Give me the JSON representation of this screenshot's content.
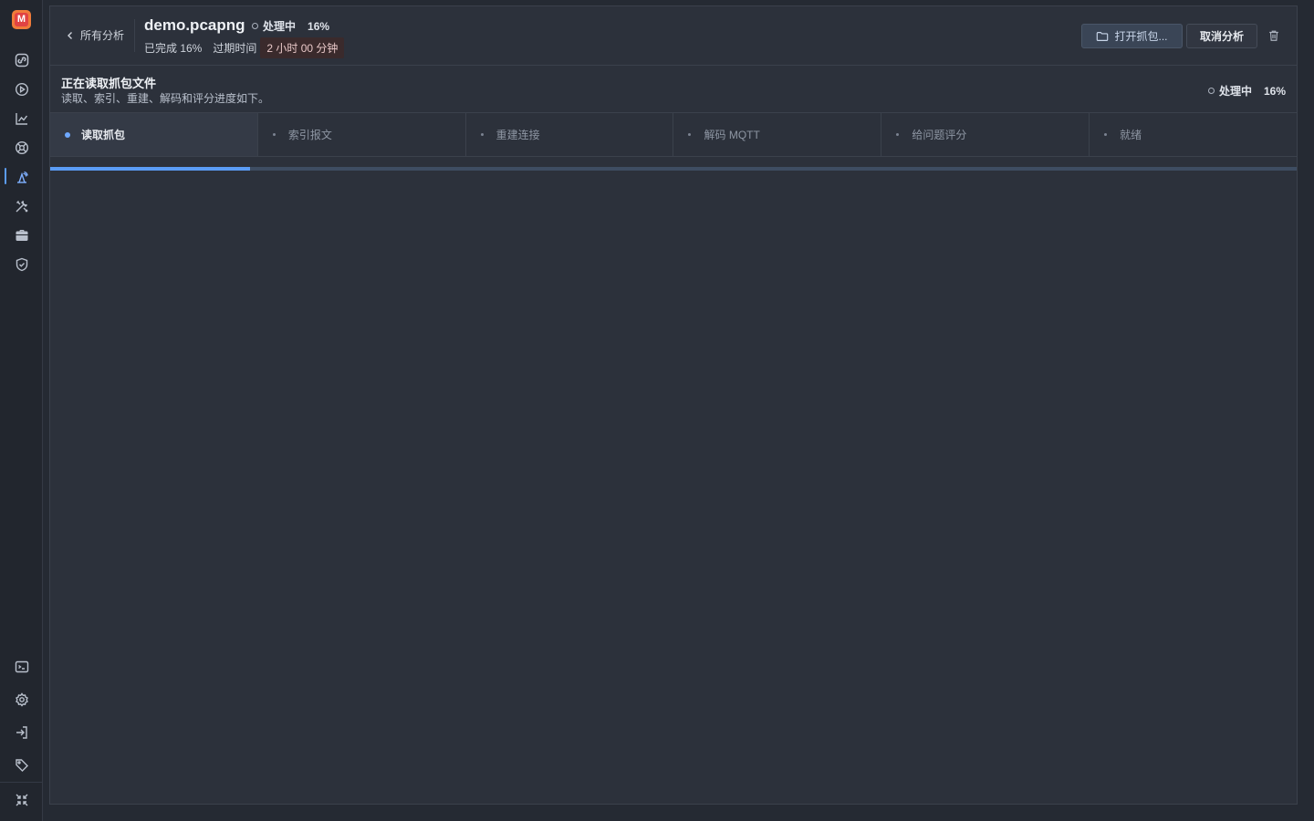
{
  "sidebar": {
    "logo_letter": "M",
    "items": [
      {
        "icon": "link-icon"
      },
      {
        "icon": "play-circle-icon"
      },
      {
        "icon": "chart-icon"
      },
      {
        "icon": "target-icon"
      },
      {
        "icon": "capture-icon",
        "active": true
      },
      {
        "icon": "tools-icon"
      },
      {
        "icon": "briefcase-icon"
      },
      {
        "icon": "shield-icon"
      }
    ],
    "bottom_items": [
      {
        "icon": "terminal-icon"
      },
      {
        "icon": "gear-icon"
      },
      {
        "icon": "login-icon"
      },
      {
        "icon": "tag-icon"
      },
      {
        "icon": "collapse-icon"
      }
    ]
  },
  "header": {
    "back_label": "所有分析",
    "file_name": "demo.pcapng",
    "status": "处理中",
    "percent": "16%",
    "completed_label": "已完成 16%",
    "expiry_label": "过期时间",
    "expiry_value": "2 小时 00 分钟",
    "open_button": "打开抓包...",
    "cancel_button": "取消分析"
  },
  "progress": {
    "title": "正在读取抓包文件",
    "description": "读取、索引、重建、解码和评分进度如下。",
    "status": "处理中",
    "percent": "16%",
    "fill_fraction": 0.16,
    "steps": [
      {
        "label": "读取抓包",
        "active": true
      },
      {
        "label": "索引报文",
        "active": false
      },
      {
        "label": "重建连接",
        "active": false
      },
      {
        "label": "解码 MQTT",
        "active": false
      },
      {
        "label": "给问题评分",
        "active": false
      },
      {
        "label": "就绪",
        "active": false
      }
    ]
  },
  "colors": {
    "accent": "#5b9cf5",
    "logo_orange": "#f07b3a",
    "logo_red": "#e14343",
    "background": "#2c313b"
  }
}
